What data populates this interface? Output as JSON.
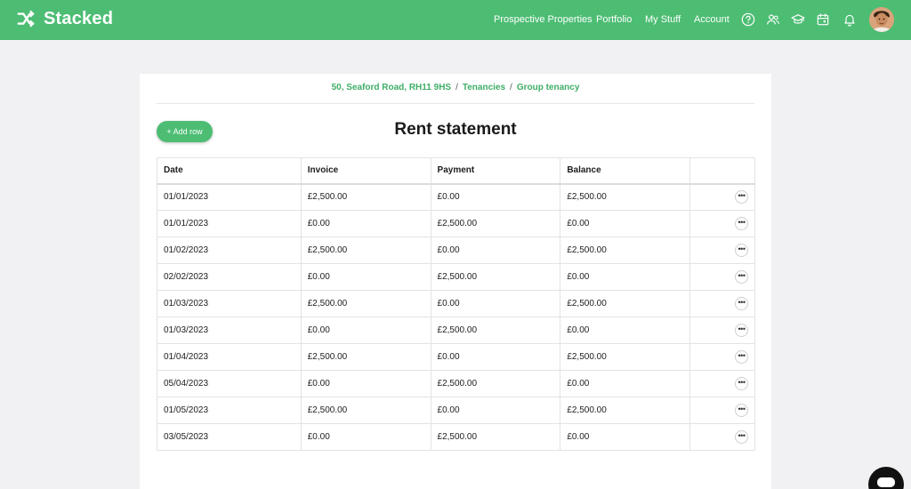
{
  "app": {
    "brand": "Stacked",
    "accent_color": "#4dbd74"
  },
  "nav": {
    "links": [
      "Prospective Properties",
      "Portfolio",
      "My Stuff",
      "Account"
    ],
    "icons": [
      "help-circle-icon",
      "users-icon",
      "graduation-cap-icon",
      "calendar-icon",
      "bell-icon"
    ]
  },
  "breadcrumb": [
    "50, Seaford Road, RH11 9HS",
    "Tenancies",
    "Group tenancy"
  ],
  "toolbar": {
    "add_row_label": "+ Add row"
  },
  "page": {
    "title": "Rent statement"
  },
  "table": {
    "columns": [
      "Date",
      "Invoice",
      "Payment",
      "Balance"
    ],
    "rows": [
      [
        "01/01/2023",
        "£2,500.00",
        "£0.00",
        "£2,500.00"
      ],
      [
        "01/01/2023",
        "£0.00",
        "£2,500.00",
        "£0.00"
      ],
      [
        "01/02/2023",
        "£2,500.00",
        "£0.00",
        "£2,500.00"
      ],
      [
        "02/02/2023",
        "£0.00",
        "£2,500.00",
        "£0.00"
      ],
      [
        "01/03/2023",
        "£2,500.00",
        "£0.00",
        "£2,500.00"
      ],
      [
        "01/03/2023",
        "£0.00",
        "£2,500.00",
        "£0.00"
      ],
      [
        "01/04/2023",
        "£2,500.00",
        "£0.00",
        "£2,500.00"
      ],
      [
        "05/04/2023",
        "£0.00",
        "£2,500.00",
        "£0.00"
      ],
      [
        "01/05/2023",
        "£2,500.00",
        "£0.00",
        "£2,500.00"
      ],
      [
        "03/05/2023",
        "£0.00",
        "£2,500.00",
        "£0.00"
      ]
    ],
    "row_action_icon": "more-horizontal-icon"
  }
}
